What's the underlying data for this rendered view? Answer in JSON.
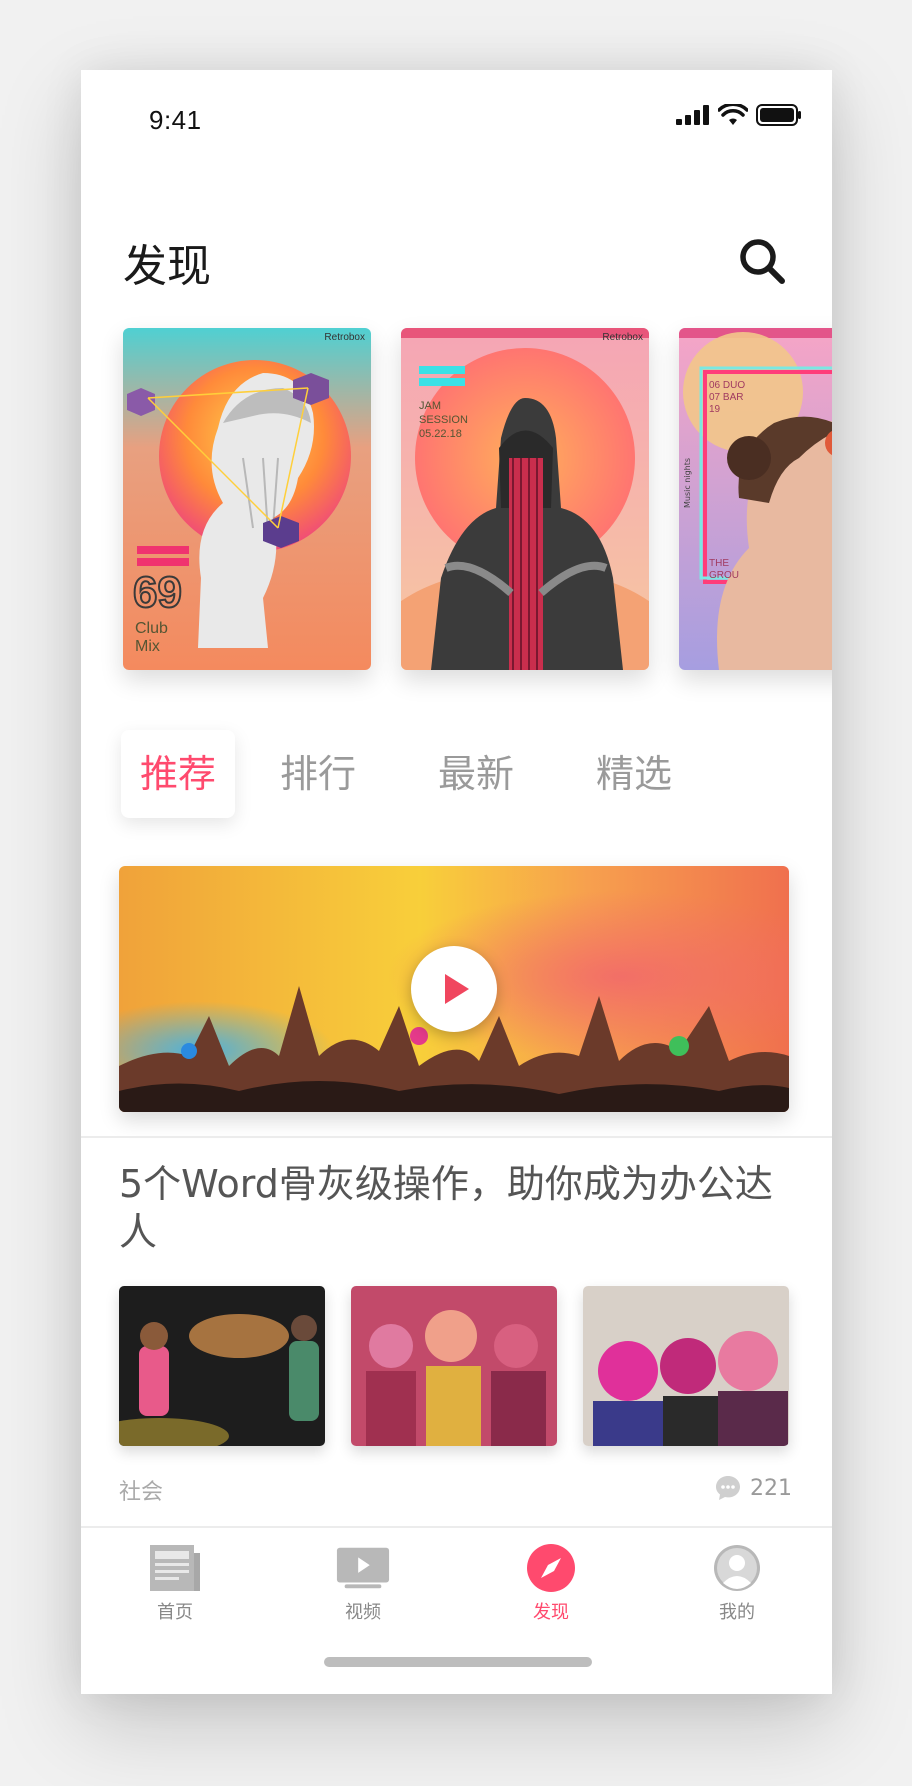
{
  "status": {
    "time": "9:41"
  },
  "header": {
    "title": "发现"
  },
  "icons": {
    "search": "search-icon",
    "play": "play-icon",
    "comment": "comment-icon"
  },
  "colors": {
    "accent": "#ff4a6e",
    "text_primary": "#1a1a1a",
    "text_secondary": "#9a9a9a"
  },
  "cards": [
    {
      "brand": "Retrobox",
      "side_text": "Retrobox",
      "number": "69",
      "line1": "Club",
      "line2": "Mix"
    },
    {
      "brand": "Retrobox",
      "line1": "JAM",
      "line2": "SESSION",
      "line3": "05.22.18"
    },
    {
      "lines": [
        "06 DUO",
        "07 BAR",
        "19"
      ],
      "side_text": "Music nights",
      "footer1": "THE",
      "footer2": "GROU"
    }
  ],
  "tabs": [
    {
      "label": "推荐",
      "active": true
    },
    {
      "label": "排行",
      "active": false
    },
    {
      "label": "最新",
      "active": false
    },
    {
      "label": "精选",
      "active": false
    }
  ],
  "article": {
    "title": "5个Word骨灰级操作，助你成为办公达人",
    "category": "社会",
    "comments": "221"
  },
  "tabbar": [
    {
      "label": "首页",
      "icon": "news-icon",
      "active": false
    },
    {
      "label": "视频",
      "icon": "video-icon",
      "active": false
    },
    {
      "label": "发现",
      "icon": "compass-icon",
      "active": true
    },
    {
      "label": "我的",
      "icon": "user-icon",
      "active": false
    }
  ]
}
